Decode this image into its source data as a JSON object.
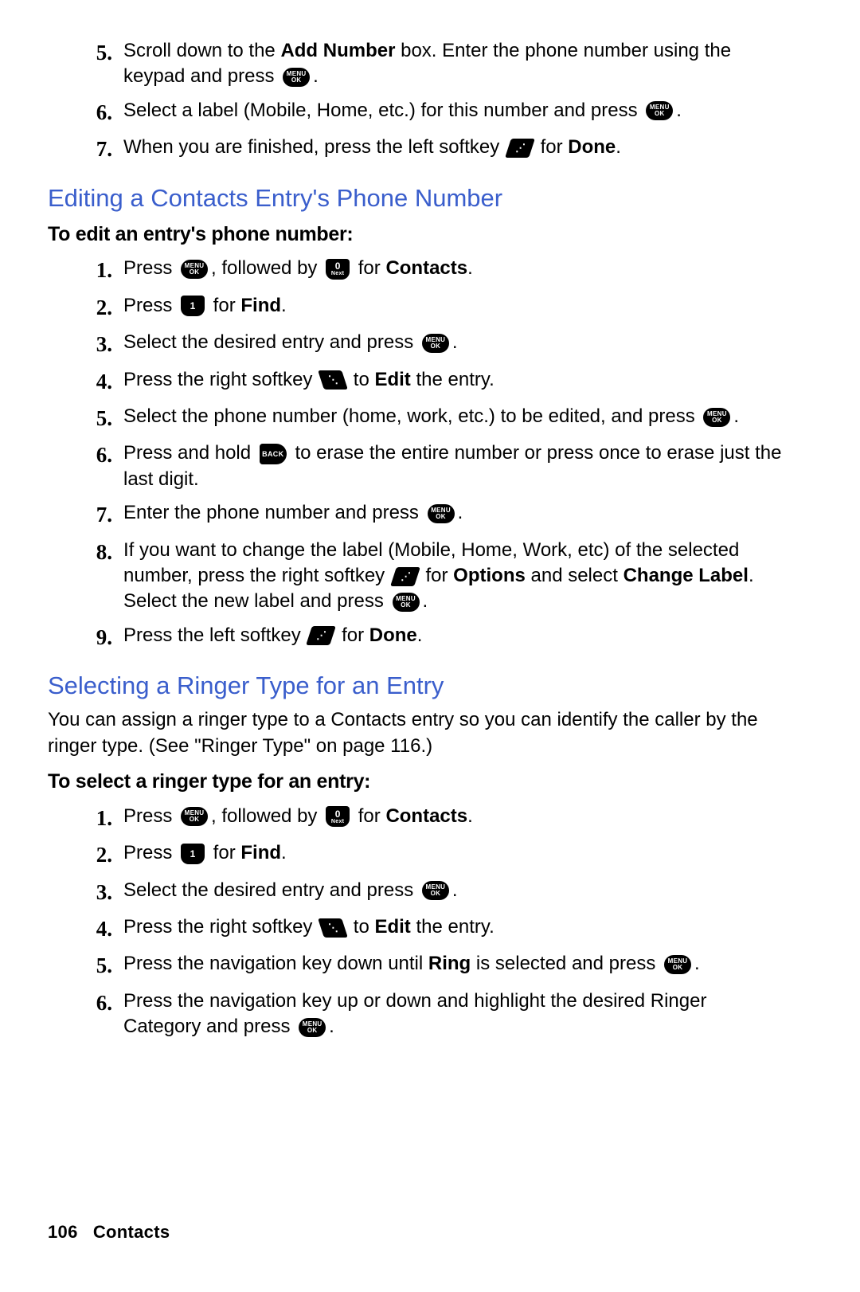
{
  "top_steps": [
    {
      "n": "5.",
      "parts": [
        "Scroll down to the ",
        {
          "b": "Add Number"
        },
        " box. Enter the phone number using the keypad and press ",
        {
          "icon": "menuok"
        },
        "."
      ]
    },
    {
      "n": "6.",
      "parts": [
        "Select a label (Mobile, Home, etc.) for this number and press ",
        {
          "icon": "menuok"
        },
        "."
      ]
    },
    {
      "n": "7.",
      "parts": [
        "When you are finished, press the left softkey ",
        {
          "icon": "softkey-left"
        },
        " for ",
        {
          "b": "Done"
        },
        "."
      ]
    }
  ],
  "section1_title": "Editing a Contacts Entry's Phone Number",
  "section1_sub": "To edit an entry's phone number:",
  "section1_steps": [
    {
      "n": "1.",
      "parts": [
        "Press ",
        {
          "icon": "menuok"
        },
        ", followed by ",
        {
          "icon": "key",
          "top": "0",
          "bot": "Next"
        },
        " for ",
        {
          "b": "Contacts"
        },
        "."
      ]
    },
    {
      "n": "2.",
      "parts": [
        "Press ",
        {
          "icon": "key",
          "top": "1",
          "bot": ""
        },
        " for ",
        {
          "b": "Find"
        },
        "."
      ]
    },
    {
      "n": "3.",
      "parts": [
        "Select the desired entry and press ",
        {
          "icon": "menuok"
        },
        "."
      ]
    },
    {
      "n": "4.",
      "parts": [
        "Press the right softkey ",
        {
          "icon": "softkey-right"
        },
        " to ",
        {
          "b": "Edit"
        },
        " the entry."
      ]
    },
    {
      "n": "5.",
      "parts": [
        "Select the phone number (home, work, etc.) to be edited, and press ",
        {
          "icon": "menuok"
        },
        "."
      ]
    },
    {
      "n": "6.",
      "parts": [
        "Press and hold ",
        {
          "icon": "back"
        },
        " to erase the entire number or press once to erase just the last digit."
      ]
    },
    {
      "n": "7.",
      "parts": [
        "Enter the phone number and press ",
        {
          "icon": "menuok"
        },
        "."
      ]
    },
    {
      "n": "8.",
      "parts": [
        "If you want to change the label (Mobile, Home, Work, etc) of the selected number, press the right softkey ",
        {
          "icon": "softkey-left"
        },
        " for ",
        {
          "b": "Options"
        },
        " and select ",
        {
          "b": "Change Label"
        },
        ". Select the new label and press ",
        {
          "icon": "menuok"
        },
        "."
      ]
    },
    {
      "n": "9.",
      "parts": [
        "Press the left softkey ",
        {
          "icon": "softkey-left"
        },
        " for ",
        {
          "b": "Done"
        },
        "."
      ]
    }
  ],
  "section2_title": "Selecting a Ringer Type for an Entry",
  "section2_intro": "You can assign a ringer type to a Contacts entry so you can identify the caller by the ringer type. (See \"Ringer Type\" on page 116.)",
  "section2_sub": "To select a ringer type for an entry:",
  "section2_steps": [
    {
      "n": "1.",
      "parts": [
        "Press ",
        {
          "icon": "menuok"
        },
        ", followed by ",
        {
          "icon": "key",
          "top": "0",
          "bot": "Next"
        },
        " for ",
        {
          "b": "Contacts"
        },
        "."
      ]
    },
    {
      "n": "2.",
      "parts": [
        "Press ",
        {
          "icon": "key",
          "top": "1",
          "bot": ""
        },
        " for ",
        {
          "b": "Find"
        },
        "."
      ]
    },
    {
      "n": "3.",
      "parts": [
        "Select the desired entry and press ",
        {
          "icon": "menuok"
        },
        "."
      ]
    },
    {
      "n": "4.",
      "parts": [
        "Press the right softkey ",
        {
          "icon": "softkey-right"
        },
        " to ",
        {
          "b": "Edit"
        },
        " the entry."
      ]
    },
    {
      "n": "5.",
      "parts": [
        "Press the navigation key down until ",
        {
          "b": "Ring"
        },
        " is selected and press ",
        {
          "icon": "menuok"
        },
        "."
      ]
    },
    {
      "n": "6.",
      "parts": [
        "Press the navigation key up or down and highlight the desired Ringer Category and press ",
        {
          "icon": "menuok"
        },
        "."
      ]
    }
  ],
  "footer_page": "106",
  "footer_section": "Contacts"
}
